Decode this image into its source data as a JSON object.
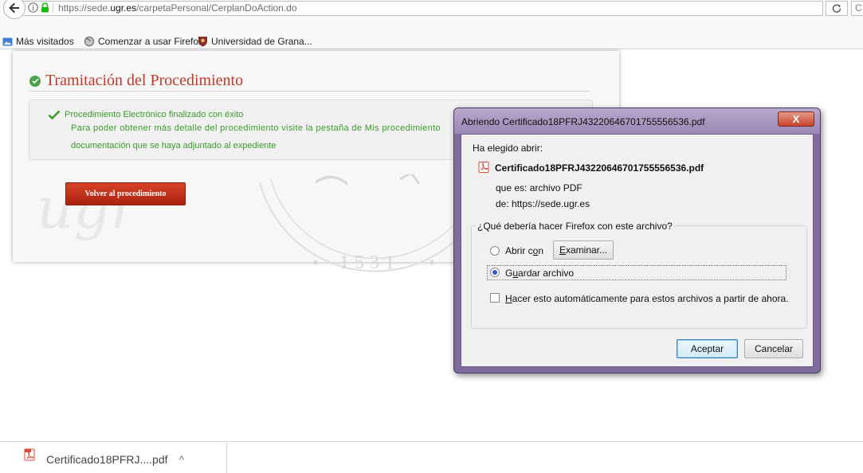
{
  "browser": {
    "url_prefix": "https://sede.",
    "url_domain": "ugr.es",
    "url_path": "/carpetaPersonal/CerplanDoAction.do",
    "search_stub": "C"
  },
  "bookmarks": [
    {
      "label": "Más visitados",
      "icon": "bookmark-folder-icon"
    },
    {
      "label": "Comenzar a usar Firefox",
      "icon": "firefox-icon"
    },
    {
      "label": "Universidad de Grana...",
      "icon": "ugr-crest-icon"
    }
  ],
  "page": {
    "title": "Tramitación del Procedimiento",
    "success_heading": "Procedimiento Electrónico finalizado con éxito",
    "detail_line1": "Para poder obtener más detalle del procedimiento visite la pestaña de Mis procedimiento",
    "detail_line2": "documentación que se haya adjuntado al expediente",
    "back_button": "Volver al procedimiento",
    "watermark_text": "ugr",
    "seal_text": "1531"
  },
  "dialog": {
    "title": "Abriendo Certificado18PFRJ43220646701755556536.pdf",
    "close_label": "X",
    "chose_label": "Ha elegido abrir:",
    "filename": "Certificado18PFRJ43220646701755556536.pdf",
    "type_line": "que es: archivo PDF",
    "from_line": "de: https://sede.ugr.es",
    "question": "¿Qué debería hacer Firefox con este archivo?",
    "open_with_pre": "Abrir c",
    "open_with_acc": "o",
    "open_with_post": "n",
    "browse_acc": "E",
    "browse_post": "xaminar...",
    "save_acc": "u",
    "save_pre": "G",
    "save_post": "ardar archivo",
    "auto_acc": "H",
    "auto_post": "acer esto automáticamente para estos archivos a partir de ahora.",
    "selected_option": "save",
    "accept_label": "Aceptar",
    "cancel_label": "Cancelar"
  },
  "downloads": {
    "item_label": "Certificado18PFRJ....pdf",
    "chevron": "^"
  },
  "colors": {
    "title_red": "#c13a28",
    "success_green": "#3b9a2b",
    "button_red": "#c4321c",
    "dialog_frame": "#7f6c9c"
  }
}
